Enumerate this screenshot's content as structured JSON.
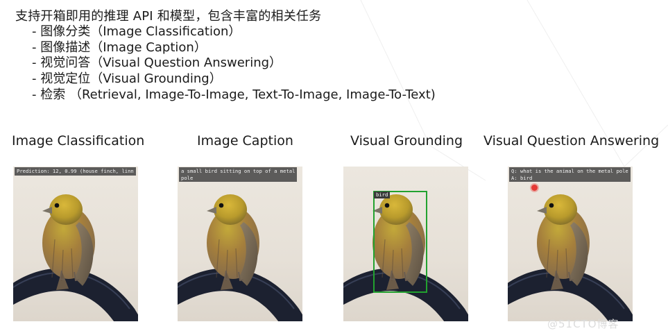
{
  "slide": {
    "heading": "支持开箱即用的推理 API 和模型，包含丰富的相关任务",
    "bullets": [
      "- 图像分类（Image Classification）",
      "- 图像描述（Image Caption）",
      "- 视觉问答（Visual Question Answering）",
      "- 视觉定位（Visual Grounding）",
      "- 检索 （Retrieval, Image-To-Image, Text-To-Image, Image-To-Text)"
    ]
  },
  "panels": [
    {
      "title": "Image Classification",
      "overlay": "Prediction: 12, 0.99 (house finch, linn"
    },
    {
      "title": "Image Caption",
      "overlay": "a small bird sitting on top of a metal\npole"
    },
    {
      "title": "Visual Grounding",
      "box_label": "bird"
    },
    {
      "title": "Visual Question Answering",
      "overlay": "Q: what is the animal on the metal pole\nA: bird"
    }
  ],
  "colors": {
    "grounding_box": "#22a22f",
    "click_marker": "#e53935"
  },
  "watermark": "@51CTO博客"
}
